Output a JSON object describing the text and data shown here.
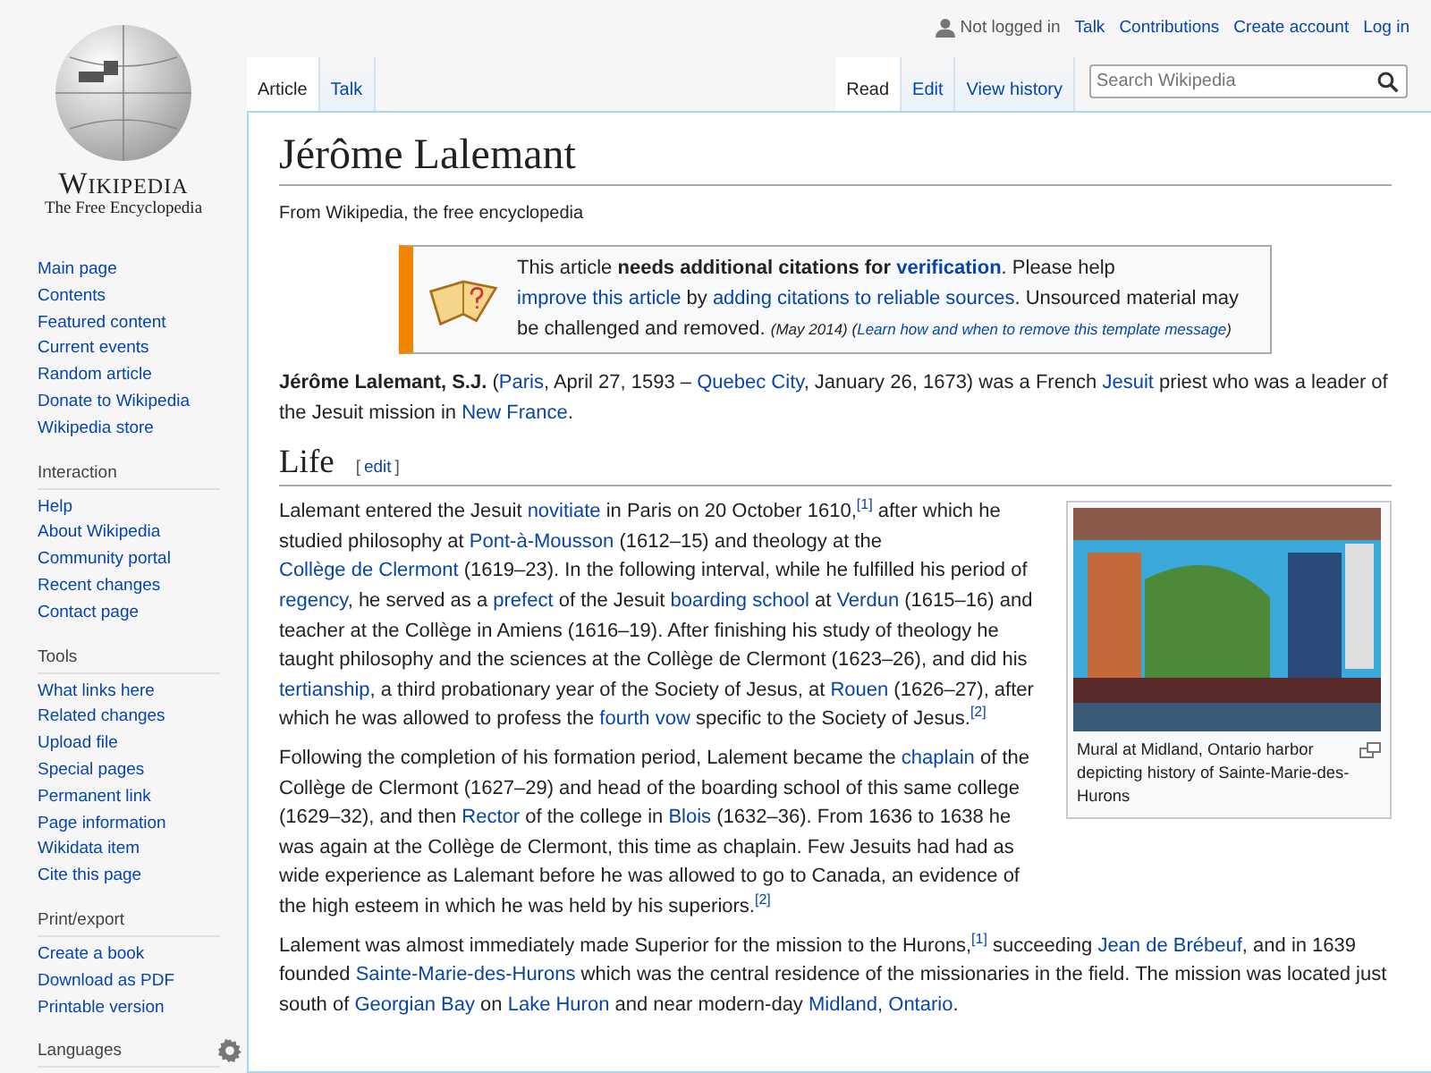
{
  "personal": {
    "status": "Not logged in",
    "links": [
      "Talk",
      "Contributions",
      "Create account",
      "Log in"
    ]
  },
  "logo": {
    "wordmark": "Wikipedia",
    "tagline": "The Free Encyclopedia"
  },
  "namespace_tabs": [
    {
      "label": "Article",
      "selected": true
    },
    {
      "label": "Talk",
      "selected": false
    }
  ],
  "view_tabs": [
    {
      "label": "Read",
      "selected": true
    },
    {
      "label": "Edit",
      "selected": false
    },
    {
      "label": "View history",
      "selected": false
    }
  ],
  "search": {
    "placeholder": "Search Wikipedia"
  },
  "sidebar": [
    {
      "items": [
        "Main page",
        "Contents",
        "Featured content",
        "Current events",
        "Random article",
        "Donate to Wikipedia",
        "Wikipedia store"
      ]
    },
    {
      "heading": "Interaction",
      "items": [
        "Help",
        "About Wikipedia",
        "Community portal",
        "Recent changes",
        "Contact page"
      ]
    },
    {
      "heading": "Tools",
      "items": [
        "What links here",
        "Related changes",
        "Upload file",
        "Special pages",
        "Permanent link",
        "Page information",
        "Wikidata item",
        "Cite this page"
      ]
    },
    {
      "heading": "Print/export",
      "items": [
        "Create a book",
        "Download as PDF",
        "Printable version"
      ]
    },
    {
      "heading": "Languages"
    }
  ],
  "title": "Jérôme Lalemant",
  "tagline": "From Wikipedia, the free encyclopedia",
  "notice": {
    "runs": [
      {
        "kind": "text",
        "t": "This article "
      },
      {
        "kind": "bold",
        "t": "needs additional citations for "
      },
      {
        "kind": "boldlink",
        "t": "verification"
      },
      {
        "kind": "text",
        "t": ". Please help "
      },
      {
        "kind": "link",
        "t": "improve this article"
      },
      {
        "kind": "text",
        "t": " by "
      },
      {
        "kind": "link",
        "t": "adding citations to reliable sources"
      },
      {
        "kind": "text",
        "t": ". Unsourced material may be challenged and removed. "
      },
      {
        "kind": "small",
        "t": "(May 2014)"
      },
      {
        "kind": "small",
        "t": " ("
      },
      {
        "kind": "smalllink",
        "t": "Learn how and when to remove this template message"
      },
      {
        "kind": "small",
        "t": ")"
      }
    ]
  },
  "lead": [
    {
      "kind": "bold",
      "t": "Jérôme Lalemant, S.J."
    },
    {
      "kind": "text",
      "t": " ("
    },
    {
      "kind": "link",
      "t": "Paris"
    },
    {
      "kind": "text",
      "t": ", April 27, 1593 – "
    },
    {
      "kind": "link",
      "t": "Quebec City"
    },
    {
      "kind": "text",
      "t": ", January 26, 1673) was a French "
    },
    {
      "kind": "link",
      "t": "Jesuit"
    },
    {
      "kind": "text",
      "t": " priest who was a leader of the Jesuit mission in "
    },
    {
      "kind": "link",
      "t": "New France"
    },
    {
      "kind": "text",
      "t": "."
    }
  ],
  "section": {
    "heading": "Life",
    "bracket_open": "[",
    "edit": "edit",
    "bracket_close": "]"
  },
  "figure": {
    "caption": "Mural at Midland, Ontario harbor depicting history of Sainte-Marie-des-Hurons"
  },
  "paragraphs": [
    [
      {
        "kind": "text",
        "t": "Lalemant entered the Jesuit "
      },
      {
        "kind": "link",
        "t": "novitiate"
      },
      {
        "kind": "text",
        "t": " in Paris on 20 October 1610,"
      },
      {
        "kind": "ref",
        "t": "[1]"
      },
      {
        "kind": "text",
        "t": " after which he studied philosophy at "
      },
      {
        "kind": "link",
        "t": "Pont-à-Mousson"
      },
      {
        "kind": "text",
        "t": " (1612–15) and theology at the "
      },
      {
        "kind": "link",
        "t": "Collège de Clermont"
      },
      {
        "kind": "text",
        "t": " (1619–23). In the following interval, while he fulfilled his period of "
      },
      {
        "kind": "link",
        "t": "regency"
      },
      {
        "kind": "text",
        "t": ", he served as a "
      },
      {
        "kind": "link",
        "t": "prefect"
      },
      {
        "kind": "text",
        "t": " of the Jesuit "
      },
      {
        "kind": "link",
        "t": "boarding school"
      },
      {
        "kind": "text",
        "t": " at "
      },
      {
        "kind": "link",
        "t": "Verdun"
      },
      {
        "kind": "text",
        "t": " (1615–16) and teacher at the Collège in Amiens (1616–19). After finishing his study of theology he taught philosophy and the sciences at the Collège de Clermont (1623–26), and did his "
      },
      {
        "kind": "link",
        "t": "tertianship"
      },
      {
        "kind": "text",
        "t": ", a third probationary year of the Society of Jesus, at "
      },
      {
        "kind": "link",
        "t": "Rouen"
      },
      {
        "kind": "text",
        "t": " (1626–27), after which he was allowed to profess the "
      },
      {
        "kind": "link",
        "t": "fourth vow"
      },
      {
        "kind": "text",
        "t": " specific to the Society of Jesus."
      },
      {
        "kind": "ref",
        "t": "[2]"
      }
    ],
    [
      {
        "kind": "text",
        "t": "Following the completion of his formation period, Lalement became the "
      },
      {
        "kind": "link",
        "t": "chaplain"
      },
      {
        "kind": "text",
        "t": " of the Collège de Clermont (1627–29) and head of the boarding school of this same college (1629–32), and then "
      },
      {
        "kind": "link",
        "t": "Rector"
      },
      {
        "kind": "text",
        "t": " of the college in "
      },
      {
        "kind": "link",
        "t": "Blois"
      },
      {
        "kind": "text",
        "t": " (1632–36). From 1636 to 1638 he was again at the Collège de Clermont, this time as chaplain. Few Jesuits had had as wide experience as Lalemant before he was allowed to go to Canada, an evidence of the high esteem in which he was held by his superiors."
      },
      {
        "kind": "ref",
        "t": "[2]"
      }
    ],
    [
      {
        "kind": "text",
        "t": "Lalement was almost immediately made Superior for the mission to the Hurons,"
      },
      {
        "kind": "ref",
        "t": "[1]"
      },
      {
        "kind": "text",
        "t": " succeeding "
      },
      {
        "kind": "link",
        "t": "Jean de Brébeuf"
      },
      {
        "kind": "text",
        "t": ", and in 1639 founded "
      },
      {
        "kind": "link",
        "t": "Sainte-Marie-des-Hurons"
      },
      {
        "kind": "text",
        "t": " which was the central residence of the missionaries in the field. The mission was located just south of "
      },
      {
        "kind": "link",
        "t": "Georgian Bay"
      },
      {
        "kind": "text",
        "t": " on "
      },
      {
        "kind": "link",
        "t": "Lake Huron"
      },
      {
        "kind": "text",
        "t": " and near modern-day "
      },
      {
        "kind": "link",
        "t": "Midland, Ontario"
      },
      {
        "kind": "text",
        "t": "."
      }
    ]
  ]
}
